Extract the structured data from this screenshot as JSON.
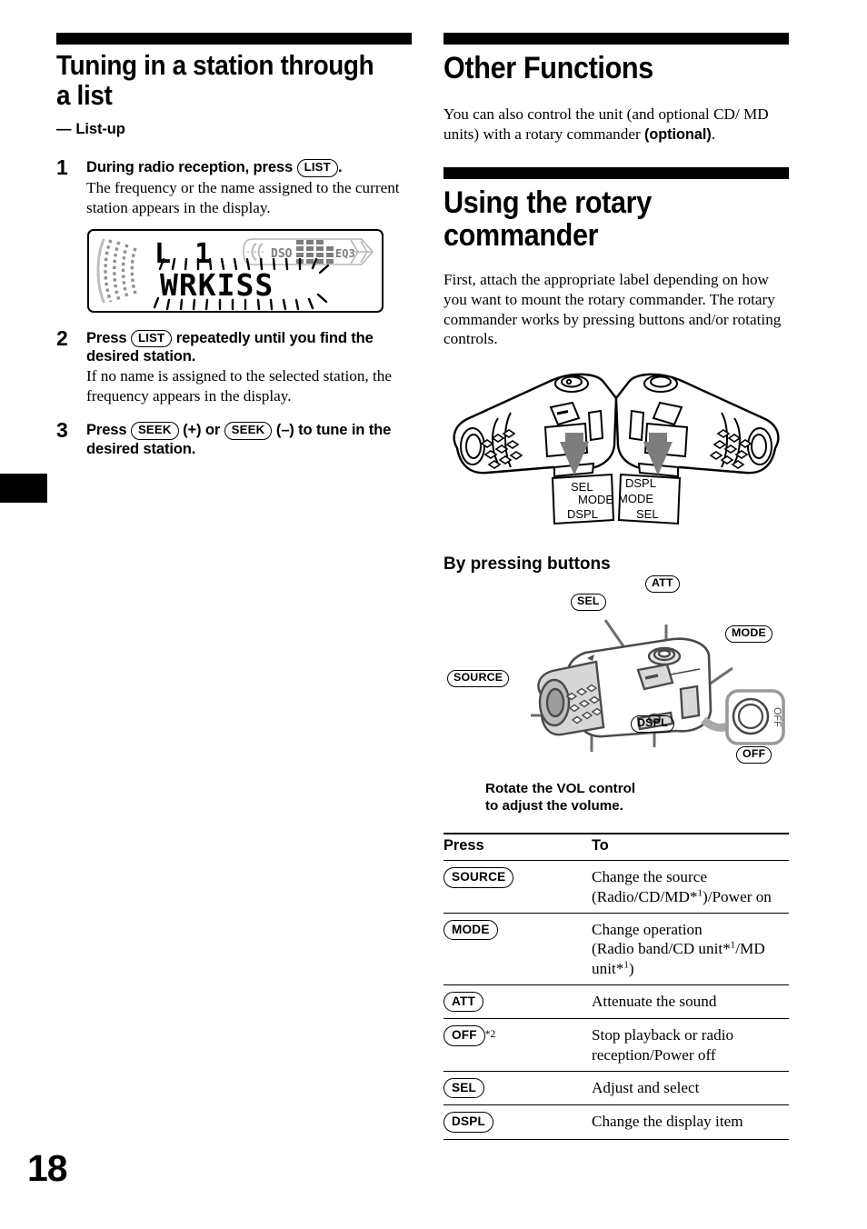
{
  "page": {
    "number": "18"
  },
  "left": {
    "heading": "Tuning in a station through\na list",
    "subheading_dash": "—",
    "subheading": "List-up",
    "steps": [
      {
        "num": "1",
        "lead_before": "During radio reception, press",
        "lead_key": "LIST",
        "lead_after": ".",
        "explanation": "The frequency or the name assigned to the current station appears in the display."
      },
      {
        "num": "2",
        "lead_before": "Press",
        "lead_key": "LIST",
        "lead_after": "repeatedly until you find the desired station.",
        "explanation": "If no name is assigned to the selected station, the frequency appears in the display."
      },
      {
        "num": "3",
        "lead_before": "Press",
        "lead_key": "SEEK",
        "lead_mid": "(+) or",
        "lead_key2": "SEEK",
        "lead_after": "(–) to tune in the desired station.",
        "explanation": ""
      }
    ],
    "display": {
      "preset": "L 1",
      "station_name": "WRKISS",
      "indicator_left": "DSO",
      "indicator_right": "EQ3"
    }
  },
  "right": {
    "heading1": "Other Functions",
    "intro1_a": "You can also control the unit (and optional CD/ MD units) with a rotary commander ",
    "intro1_bold": "(optional)",
    "intro1_b": ".",
    "heading2": "Using the rotary commander",
    "intro2": "First, attach the appropriate label depending on how you want to mount the rotary commander. The rotary commander works by pressing buttons and/or rotating controls.",
    "label_left": [
      "SEL",
      "MODE",
      "DSPL"
    ],
    "label_right": [
      "DSPL",
      "MODE",
      "SEL"
    ],
    "diagram_heading": "By pressing buttons",
    "callouts": {
      "att": "ATT",
      "sel": "SEL",
      "mode": "MODE",
      "source": "SOURCE",
      "dspl": "DSPL",
      "off": "OFF",
      "off_knob": "OFF"
    },
    "vol_caption": "Rotate the VOL control\nto adjust the volume.",
    "table": {
      "headers": [
        "Press",
        "To"
      ],
      "rows": [
        {
          "key": "SOURCE",
          "note": "",
          "desc": "Change the source\n(Radio/CD/MD*1)/Power on"
        },
        {
          "key": "MODE",
          "note": "",
          "desc": "Change operation\n(Radio band/CD unit*1/MD\nunit*1)"
        },
        {
          "key": "ATT",
          "note": "",
          "desc": "Attenuate the sound"
        },
        {
          "key": "OFF",
          "note": "*2",
          "desc": "Stop playback or radio\nreception/Power off"
        },
        {
          "key": "SEL",
          "note": "",
          "desc": "Adjust and select"
        },
        {
          "key": "DSPL",
          "note": "",
          "desc": "Change the display item"
        }
      ]
    }
  },
  "colors": {
    "ink": "#000000",
    "gray_mid": "#8c8c8c",
    "gray_light": "#c9c9c9"
  }
}
